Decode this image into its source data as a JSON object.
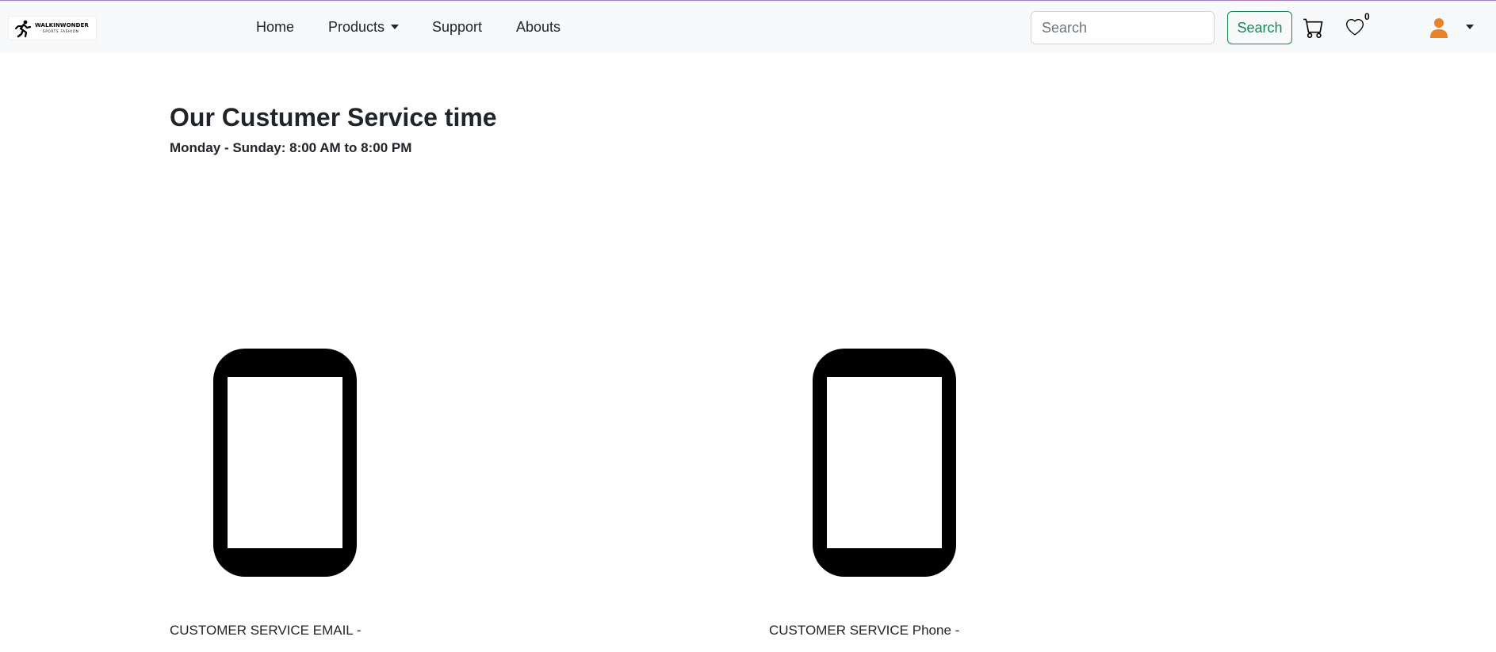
{
  "brand": {
    "title": "WALKINWONDER",
    "subtitle": "SPORTS FASHION"
  },
  "nav": {
    "items": [
      {
        "label": "Home"
      },
      {
        "label": "Products",
        "has_dropdown": true
      },
      {
        "label": "Support"
      },
      {
        "label": "Abouts"
      }
    ]
  },
  "search": {
    "placeholder": "Search",
    "value": "",
    "button_label": "Search"
  },
  "actions": {
    "cart_icon": "cart-icon",
    "wishlist_icon": "heart-icon",
    "wishlist_count": "0",
    "account_icon": "user-icon",
    "account_color": "#e8832a"
  },
  "main": {
    "title": "Our Custumer Service time",
    "hours": "Monday - Sunday: 8:00 AM to 8:00 PM",
    "contacts": [
      {
        "icon": "phone-icon",
        "label": "CUSTOMER SERVICE EMAIL -"
      },
      {
        "icon": "phone-icon",
        "label": "CUSTOMER SERVICE Phone -"
      }
    ]
  },
  "colors": {
    "navbar_bg": "#f8f9fa",
    "accent_green": "#198754",
    "top_border": "#a07cc5"
  }
}
